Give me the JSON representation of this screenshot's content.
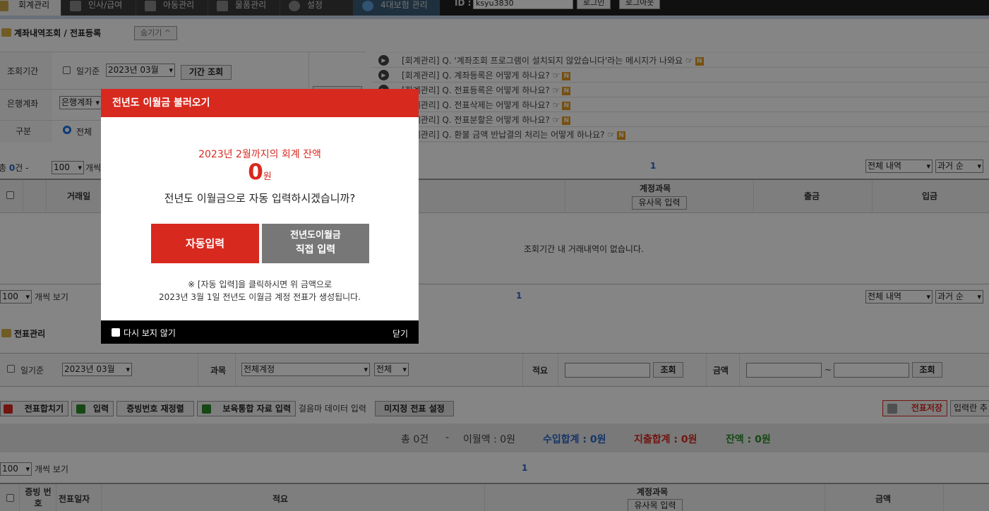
{
  "nav": {
    "tabs": [
      "회계관리",
      "인사/급여",
      "아동관리",
      "물품관리",
      "설정",
      "4대보험 관리"
    ],
    "id_label": "ID :",
    "id_value": "ksyu3830",
    "login": "로그인",
    "logout": "로그아웃"
  },
  "top": {
    "title": "계좌내역조회 / 전표등록",
    "hide_btn": "숨기기 ^",
    "period_label": "조회기간",
    "daily_label": "일기준",
    "month_value": "2023년 03월",
    "period_btn": "기간 조회",
    "bank_label": "은행계좌",
    "bank_value": "은행계좌",
    "type_label": "구분",
    "type_all": "전체"
  },
  "faq": [
    {
      "text": "[회계관리] Q. '계좌조회 프로그램이 설치되지 않았습니다'라는 메시지가 나와요 ☞"
    },
    {
      "text": "[회계관리] Q. 계좌등록은 어떻게 하나요? ☞"
    },
    {
      "text": "[회계관리] Q. 전표등록은 어떻게 하나요? ☞"
    },
    {
      "text": "[회계관리] Q. 전표삭제는 어떻게 하나요? ☞"
    },
    {
      "text": "[회계관리] Q. 전표분할은 어떻게 하나요? ☞"
    },
    {
      "text": "[회계관리] Q. 환불 금액 반납결의 처리는 어떻게 하나요? ☞"
    }
  ],
  "badge": "N",
  "list1": {
    "total_prefix": "총",
    "total_count": "0",
    "total_suffix": "건 -",
    "per_page": "100",
    "per_label": "개씩",
    "page": "1",
    "filter": "전체 내역",
    "order": "과거 순"
  },
  "table1": {
    "col_date": "거래일",
    "col_account": "계정과목",
    "col_account_btn": "유사목 입력",
    "col_out": "출금",
    "col_in": "입금",
    "empty": "조회기간 내 거래내역이 없습니다."
  },
  "list2": {
    "per_page": "100",
    "per_label": "개씩 보기",
    "page": "1",
    "filter": "전체 내역",
    "order": "과거 순"
  },
  "voucher": {
    "title": "전표관리",
    "daily_label": "일기준",
    "month_value": "2023년 03월",
    "subject_label": "과목",
    "subject_value": "전체계정",
    "subject_sub": "전체",
    "summary_label": "적요",
    "search": "조회",
    "amount_label": "금액",
    "tilde": "~"
  },
  "toolbar": {
    "merge": "전표합치기",
    "input": "입력",
    "renumber": "증빙번호 재정렬",
    "bulk": "보육통합 자료 입력",
    "walk": "걸음마 데이터 입력",
    "unset": "미지정 전표 설정",
    "save": "전표저장",
    "input_col": "입력란 추"
  },
  "summary": {
    "total": "총 0건",
    "dash": "-",
    "carry": "이월액 : 0원",
    "income": "수입합계 : 0원",
    "expense": "지출합계 : 0원",
    "balance": "잔액 : 0원"
  },
  "list3": {
    "per_page": "100",
    "per_label": "개씩 보기",
    "page": "1"
  },
  "table2": {
    "col_no": "증빙 번호",
    "col_date": "전표일자",
    "col_summary": "적요",
    "col_account": "계정과목",
    "col_account_btn": "유사목 입력",
    "col_amount": "금액"
  },
  "modal": {
    "title": "전년도 이월금 불러오기",
    "balance_label": "2023년 2월까지의 회계 잔액",
    "amount": "0",
    "unit": "원",
    "question": "전년도 이월금으로 자동 입력하시겠습니까?",
    "auto_btn": "자동입력",
    "manual_line1": "전년도이월금",
    "manual_line2": "직접 입력",
    "note1": "※ [자동 입력]을 클릭하시면 위 금액으로",
    "note2": "2023년 3월 1일 전년도 이월금 계정 전표가 생성됩니다.",
    "dont_show": "다시 보지 않기",
    "close": "닫기"
  },
  "colors": {
    "accent": "#d8291f",
    "income": "#2a67c9",
    "expense": "#d8291f",
    "balance": "#2b8a2b"
  }
}
